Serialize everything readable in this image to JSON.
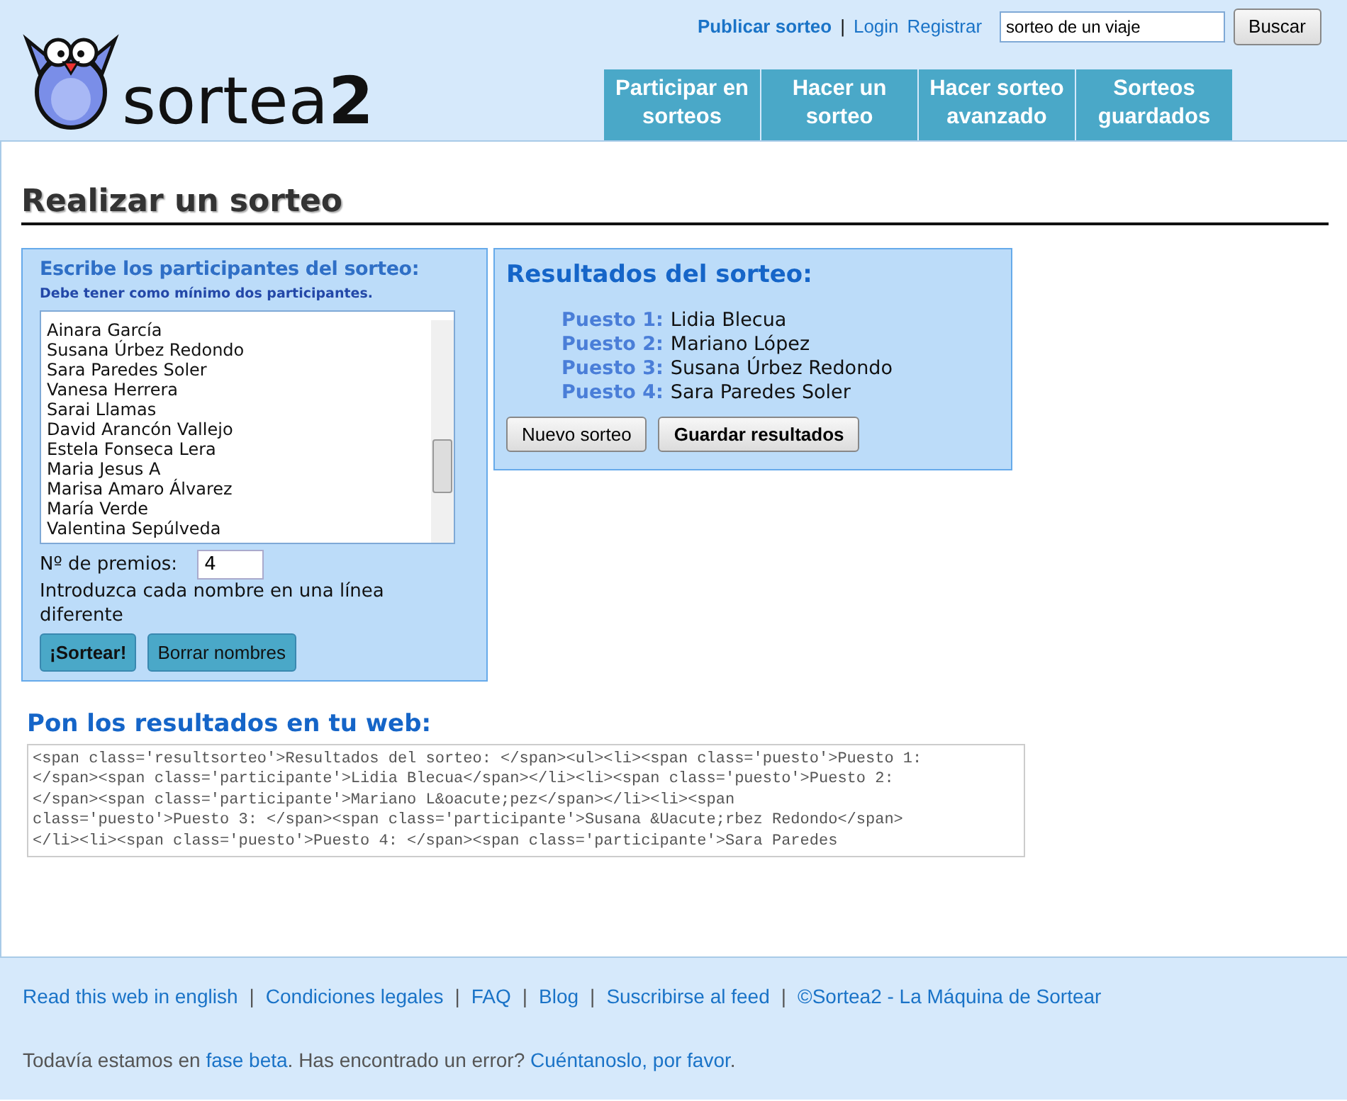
{
  "header": {
    "links": [
      {
        "label": "Publicar sorteo",
        "bold": true
      },
      {
        "label": "|",
        "kind": "separator"
      },
      {
        "label": "Login",
        "bold": false
      },
      {
        "label": "Registrar",
        "bold": false
      }
    ],
    "search": {
      "value": "sorteo de un viaje",
      "button": "Buscar"
    },
    "logo": {
      "text": "sortea",
      "suffix": "2"
    },
    "nav": [
      {
        "label": "Participar en sorteos"
      },
      {
        "label": "Hacer un sorteo"
      },
      {
        "label": "Hacer sorteo avanzado"
      },
      {
        "label": "Sorteos guardados"
      }
    ]
  },
  "page_title": "Realizar un sorteo",
  "participants_panel": {
    "title": "Escribe los participantes del sorteo:",
    "hint": "Debe tener como mínimo dos participantes.",
    "names": [
      "Ainara García",
      "Susana Úrbez Redondo",
      "Sara Paredes Soler",
      "Vanesa Herrera",
      "Sarai Llamas",
      "David Arancón Vallejo",
      "Estela Fonseca Lera",
      "Maria Jesus A",
      "Marisa Amaro Álvarez",
      "María Verde",
      "Valentina Sepúlveda"
    ],
    "prizes_label": "Nº de premios:",
    "prizes_value": "4",
    "instructions": "Introduzca cada nombre en una línea diferente",
    "buttons": [
      {
        "label": "¡Sortear!",
        "bold": true
      },
      {
        "label": "Borrar nombres",
        "bold": false
      }
    ]
  },
  "results_panel": {
    "title": "Resultados del sorteo:",
    "results": [
      {
        "place": "Puesto 1:",
        "name": "Lidia Blecua"
      },
      {
        "place": "Puesto 2:",
        "name": "Mariano López"
      },
      {
        "place": "Puesto 3:",
        "name": "Susana Úrbez Redondo"
      },
      {
        "place": "Puesto 4:",
        "name": "Sara Paredes Soler"
      }
    ],
    "buttons": [
      {
        "label": "Nuevo sorteo",
        "bold": false
      },
      {
        "label": "Guardar resultados",
        "bold": true
      }
    ]
  },
  "embed": {
    "title": "Pon los resultados en tu web:",
    "code": "<span class='resultsorteo'>Resultados del sorteo: </span><ul><li><span class='puesto'>Puesto 1: </span><span class='participante'>Lidia Blecua</span></li><li><span class='puesto'>Puesto 2: </span><span class='participante'>Mariano L&oacute;pez</span></li><li><span class='puesto'>Puesto 3: </span><span class='participante'>Susana &Uacute;rbez Redondo</span></li><li><span class='puesto'>Puesto 4: </span><span class='participante'>Sara Paredes"
  },
  "footer": {
    "links": [
      {
        "label": "Read this web in english",
        "kind": "link"
      },
      {
        "label": "|",
        "kind": "separator"
      },
      {
        "label": "Condiciones legales",
        "kind": "link"
      },
      {
        "label": "|",
        "kind": "separator"
      },
      {
        "label": "FAQ",
        "kind": "link"
      },
      {
        "label": "|",
        "kind": "separator"
      },
      {
        "label": "Blog",
        "kind": "link"
      },
      {
        "label": "|",
        "kind": "separator"
      },
      {
        "label": "Suscribirse al feed",
        "kind": "link"
      },
      {
        "label": "|",
        "kind": "separator"
      },
      {
        "label": "©Sortea2 - La Máquina de Sortear",
        "kind": "link"
      }
    ],
    "note": [
      {
        "text": "Todavía estamos en ",
        "link": false
      },
      {
        "text": "fase beta",
        "link": true
      },
      {
        "text": ". Has encontrado un error? ",
        "link": false
      },
      {
        "text": "Cuéntanoslo, por favor",
        "link": true
      },
      {
        "text": ".",
        "link": false
      }
    ]
  }
}
